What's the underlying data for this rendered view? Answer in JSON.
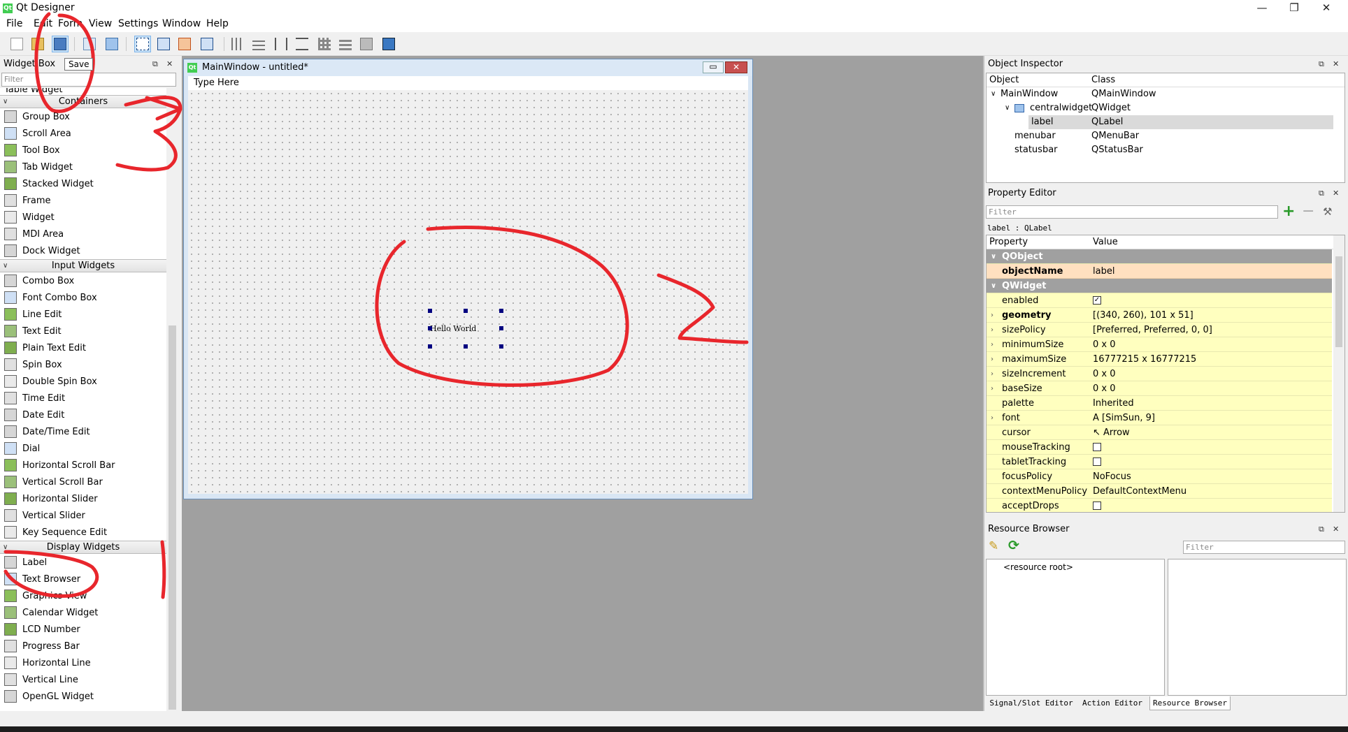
{
  "window": {
    "title": "Qt Designer",
    "minimize": "—",
    "maximize": "❐",
    "close": "✕"
  },
  "menu": [
    "File",
    "Edit",
    "Form",
    "View",
    "Settings",
    "Window",
    "Help"
  ],
  "tooltip": "Save",
  "widget_box": {
    "title": "Widget Box",
    "filter_placeholder": "Filter",
    "partial_item": "Table Widget",
    "categories": [
      {
        "name": "Containers",
        "items": [
          "Group Box",
          "Scroll Area",
          "Tool Box",
          "Tab Widget",
          "Stacked Widget",
          "Frame",
          "Widget",
          "MDI Area",
          "Dock Widget"
        ]
      },
      {
        "name": "Input Widgets",
        "items": [
          "Combo Box",
          "Font Combo Box",
          "Line Edit",
          "Text Edit",
          "Plain Text Edit",
          "Spin Box",
          "Double Spin Box",
          "Time Edit",
          "Date Edit",
          "Date/Time Edit",
          "Dial",
          "Horizontal Scroll Bar",
          "Vertical Scroll Bar",
          "Horizontal Slider",
          "Vertical Slider",
          "Key Sequence Edit"
        ]
      },
      {
        "name": "Display Widgets",
        "items": [
          "Label",
          "Text Browser",
          "Graphics View",
          "Calendar Widget",
          "LCD Number",
          "Progress Bar",
          "Horizontal Line",
          "Vertical Line",
          "OpenGL Widget"
        ]
      }
    ]
  },
  "form": {
    "title": "MainWindow - untitled*",
    "menubar_placeholder": "Type Here",
    "label_text": "Hello World"
  },
  "object_inspector": {
    "title": "Object Inspector",
    "col_object": "Object",
    "col_class": "Class",
    "rows": [
      {
        "object": "MainWindow",
        "class": "QMainWindow"
      },
      {
        "object": "centralwidget",
        "class": "QWidget"
      },
      {
        "object": "label",
        "class": "QLabel"
      },
      {
        "object": "menubar",
        "class": "QMenuBar"
      },
      {
        "object": "statusbar",
        "class": "QStatusBar"
      }
    ]
  },
  "property_editor": {
    "title": "Property Editor",
    "filter_placeholder": "Filter",
    "subtitle": "label : QLabel",
    "col_property": "Property",
    "col_value": "Value",
    "groups": {
      "qobject": "QObject",
      "qwidget": "QWidget"
    },
    "rows": [
      {
        "name": "objectName",
        "value": "label"
      },
      {
        "name": "enabled",
        "value": "✓"
      },
      {
        "name": "geometry",
        "value": "[(340, 260), 101 x 51]"
      },
      {
        "name": "sizePolicy",
        "value": "[Preferred, Preferred, 0, 0]"
      },
      {
        "name": "minimumSize",
        "value": "0 x 0"
      },
      {
        "name": "maximumSize",
        "value": "16777215 x 16777215"
      },
      {
        "name": "sizeIncrement",
        "value": "0 x 0"
      },
      {
        "name": "baseSize",
        "value": "0 x 0"
      },
      {
        "name": "palette",
        "value": "Inherited"
      },
      {
        "name": "font",
        "value": "[SimSun, 9]"
      },
      {
        "name": "cursor",
        "value": "Arrow"
      },
      {
        "name": "mouseTracking",
        "value": ""
      },
      {
        "name": "tabletTracking",
        "value": ""
      },
      {
        "name": "focusPolicy",
        "value": "NoFocus"
      },
      {
        "name": "contextMenuPolicy",
        "value": "DefaultContextMenu"
      },
      {
        "name": "acceptDrops",
        "value": ""
      }
    ]
  },
  "resource_browser": {
    "title": "Resource Browser",
    "filter_placeholder": "Filter",
    "root": "<resource root>"
  },
  "bottom_tabs": [
    "Signal/Slot Editor",
    "Action Editor",
    "Resource Browser"
  ],
  "colors": {
    "annotation": "#e8262c",
    "selection_handle": "#000080"
  }
}
